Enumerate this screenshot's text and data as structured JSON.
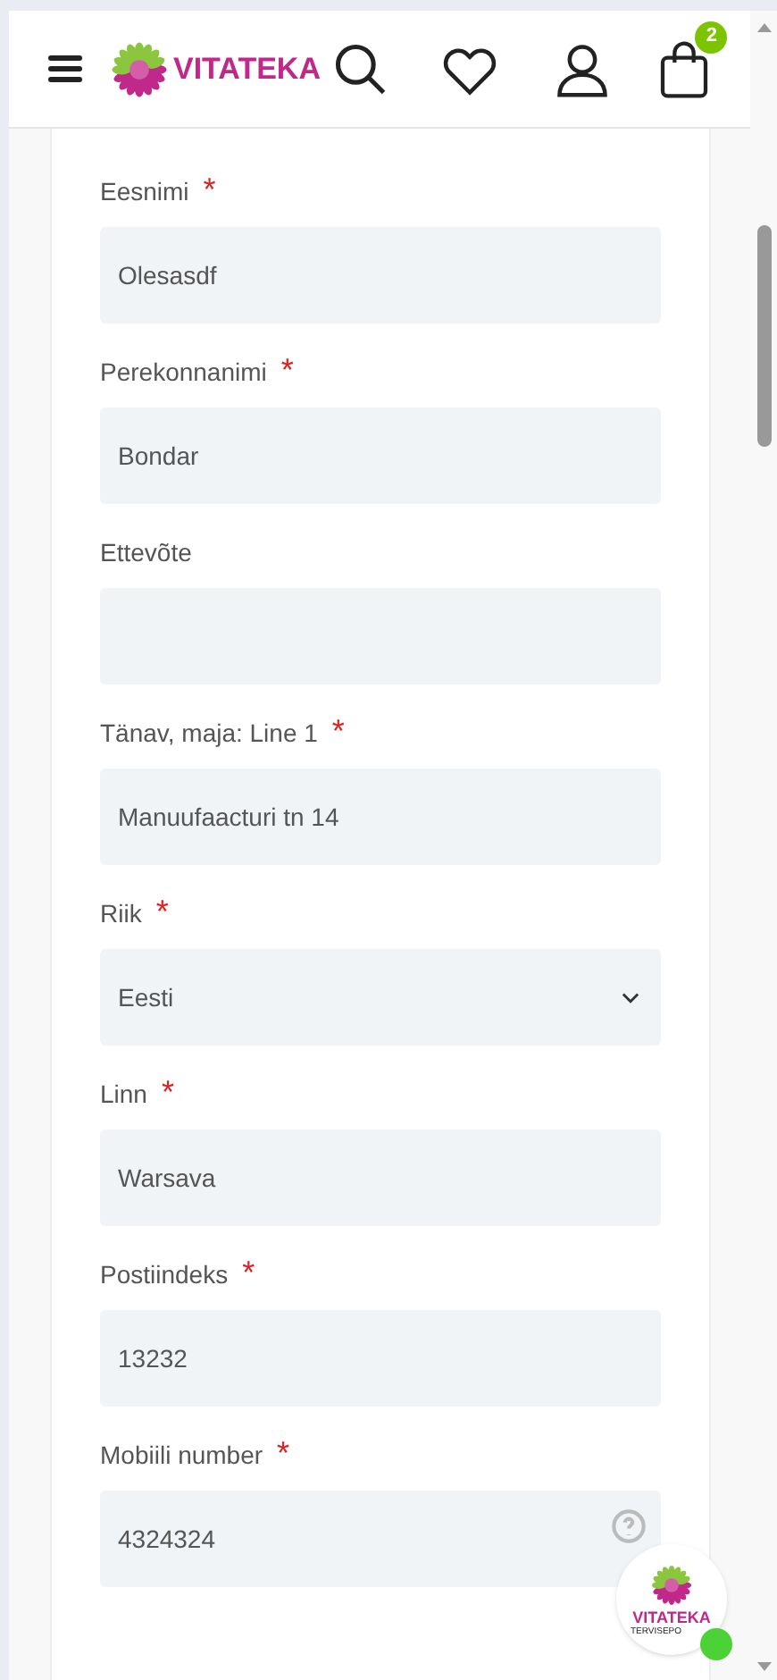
{
  "header": {
    "logo": "VITATEKA",
    "cart_count": "2"
  },
  "fields": [
    {
      "label": "Eesnimi",
      "required_mark": "*",
      "kind": "text",
      "value": "Olesasdf",
      "help": false
    },
    {
      "label": "Perekonnanimi",
      "required_mark": "*",
      "kind": "text",
      "value": "Bondar",
      "help": false
    },
    {
      "label": "Ettevõte",
      "kind": "text",
      "help": false
    },
    {
      "label": "Tänav, maja: Line 1",
      "required_mark": "*",
      "kind": "text",
      "value": "Manuufaacturi tn 14",
      "help": false
    },
    {
      "label": "Riik",
      "required_mark": "*",
      "kind": "select",
      "value": "Eesti",
      "help": false
    },
    {
      "label": "Linn",
      "required_mark": "*",
      "kind": "text",
      "value": "Warsava",
      "help": false
    },
    {
      "label": "Postiindeks",
      "required_mark": "*",
      "kind": "text",
      "value": "13232",
      "help": false
    },
    {
      "label": "Mobiili number",
      "required_mark": "*",
      "kind": "text",
      "value": "4324324",
      "help": true
    }
  ],
  "chat_widget": {
    "title": "VITATEKA",
    "subtitle": "TERVISEPO",
    "online": true
  }
}
